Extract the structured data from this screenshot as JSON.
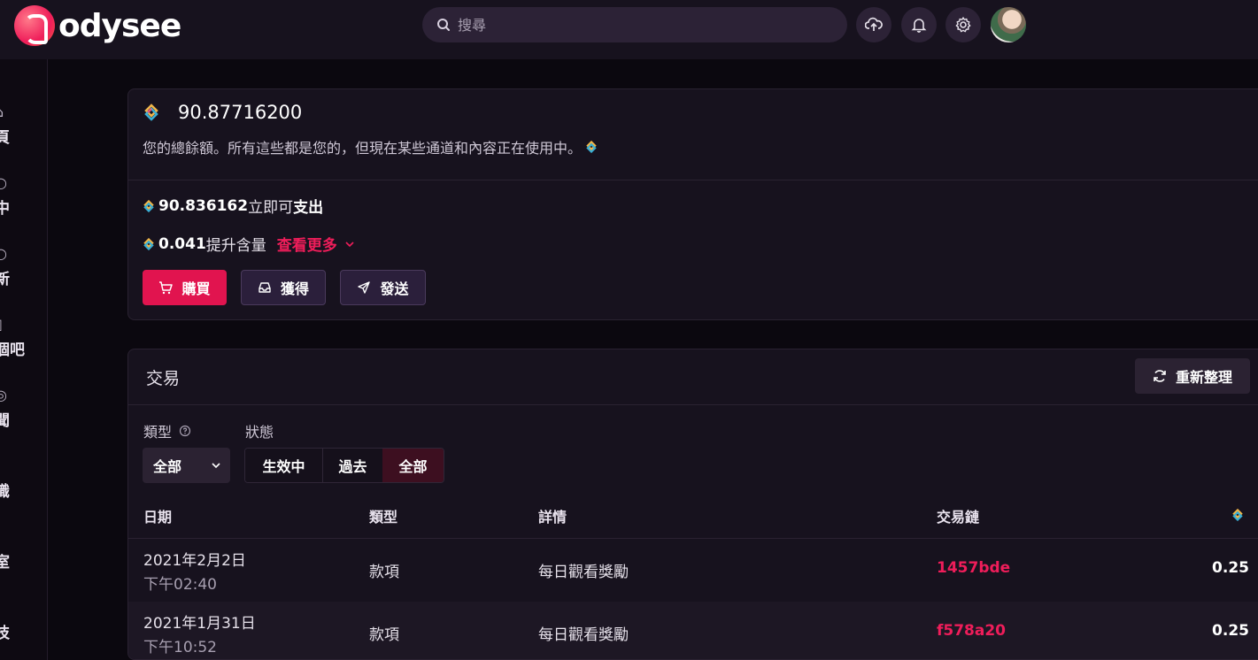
{
  "header": {
    "logo_text": "odysee",
    "search_placeholder": "搜尋"
  },
  "sidebar": {
    "items": [
      {
        "label": "頁"
      },
      {
        "label": "中"
      },
      {
        "label": "新"
      },
      {
        "label": "個吧"
      },
      {
        "label": "聞"
      },
      {
        "label": "識"
      },
      {
        "label": "室"
      },
      {
        "label": "技"
      }
    ]
  },
  "balance": {
    "total": "90.87716200",
    "description": "您的總餘額。所有這些都是您的，但現在某些通道和內容正在使用中。",
    "spendable_amount": "90.836162",
    "spendable_text_pre": "立即可",
    "spendable_text_bold": "支出",
    "boost_amount": "0.041",
    "boost_text": "提升含量",
    "see_more": "查看更多",
    "buttons": {
      "buy": "購買",
      "earn": "獲得",
      "send": "發送"
    }
  },
  "transactions": {
    "title": "交易",
    "refresh": "重新整理",
    "filter_type_label": "類型",
    "filter_status_label": "狀態",
    "type_select_value": "全部",
    "status_options": [
      "生效中",
      "過去",
      "全部"
    ],
    "status_selected": "全部",
    "columns": {
      "date": "日期",
      "type": "類型",
      "details": "詳情",
      "txid": "交易鏈"
    },
    "rows": [
      {
        "date": "2021年2月2日",
        "time": "下午02:40",
        "type": "款項",
        "details": "每日觀看獎勵",
        "txid": "1457bde",
        "amount": "0.25"
      },
      {
        "date": "2021年1月31日",
        "time": "下午10:52",
        "type": "款項",
        "details": "每日觀看獎勵",
        "txid": "f578a20",
        "amount": "0.25"
      }
    ]
  },
  "colors": {
    "accent": "#ef1d5a",
    "background": "#0b080f",
    "card": "#17121e"
  }
}
